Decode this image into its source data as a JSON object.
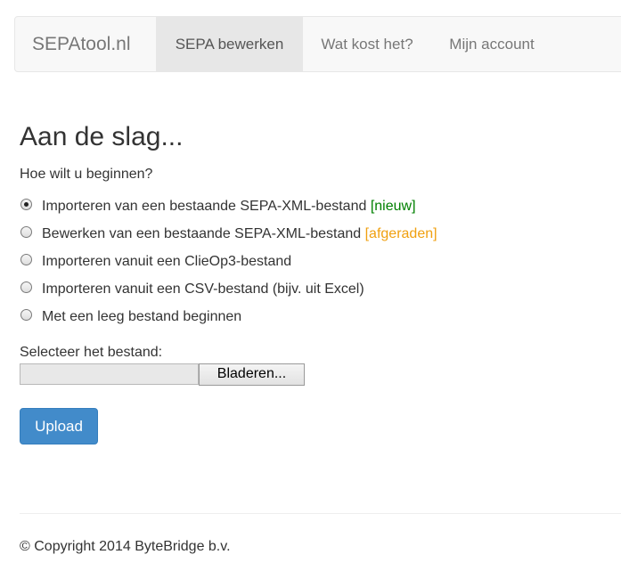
{
  "navbar": {
    "brand": "SEPAtool.nl",
    "items": [
      {
        "label": "SEPA bewerken",
        "active": true
      },
      {
        "label": "Wat kost het?",
        "active": false
      },
      {
        "label": "Mijn account",
        "active": false
      }
    ]
  },
  "main": {
    "title": "Aan de slag...",
    "question": "Hoe wilt u beginnen?",
    "options": [
      {
        "label": "Importeren van een bestaande SEPA-XML-bestand",
        "tag": "[nieuw]",
        "checked": true
      },
      {
        "label": "Bewerken van een bestaande SEPA-XML-bestand",
        "tag": "[afgeraden]",
        "checked": false
      },
      {
        "label": "Importeren vanuit een ClieOp3-bestand",
        "tag": "",
        "checked": false
      },
      {
        "label": "Importeren vanuit een CSV-bestand (bijv. uit Excel)",
        "tag": "",
        "checked": false
      },
      {
        "label": "Met een leeg bestand beginnen",
        "tag": "",
        "checked": false
      }
    ],
    "file_label": "Selecteer het bestand:",
    "browse_label": "Bladeren...",
    "upload_label": "Upload"
  },
  "footer": {
    "copyright": "© Copyright 2014 ByteBridge b.v."
  },
  "colors": {
    "tag_new": "#008000",
    "tag_discouraged": "#f0a010",
    "primary_button": "#428bca"
  }
}
